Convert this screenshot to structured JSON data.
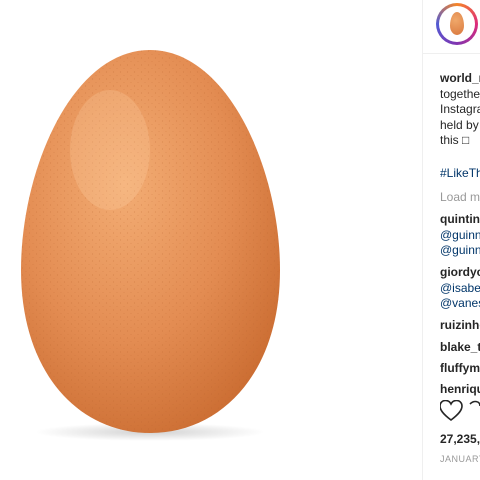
{
  "photo": {
    "subject": "egg-image",
    "background_color": "#ffffff",
    "egg_color": "#e8945a"
  },
  "post": {
    "username": "world_r",
    "caption_lines": [
      "togethe",
      "Instagra",
      "held by",
      "this □"
    ],
    "hashtag": "#LikeTh",
    "load_more": "Load m"
  },
  "comments": [
    {
      "user": "quintin",
      "lines": [
        "@guinn",
        "@guinn"
      ]
    },
    {
      "user": "giordyc",
      "lines": [
        "@isabe",
        "@vanes"
      ]
    },
    {
      "user": "ruizinhc",
      "lines": []
    },
    {
      "user": "blake_t",
      "lines": []
    },
    {
      "user": "fluffym",
      "lines": []
    },
    {
      "user": "henriqu",
      "lines": []
    }
  ],
  "likes_count": "27,235,",
  "date": "JANUARY",
  "colors": {
    "link": "#003569",
    "muted": "#999999",
    "text": "#262626"
  }
}
